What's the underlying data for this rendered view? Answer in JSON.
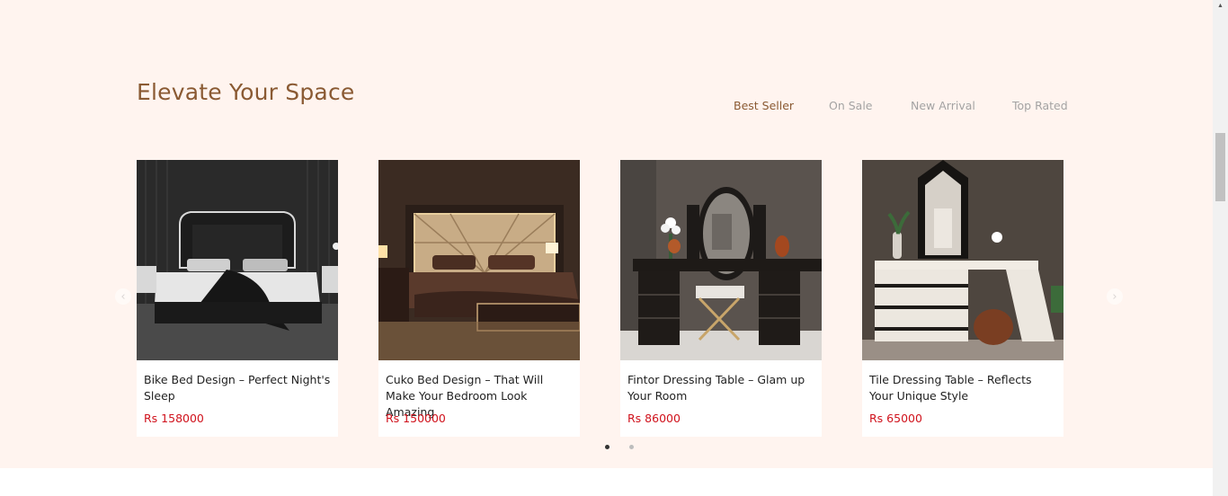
{
  "section": {
    "heading": "Elevate Your Space",
    "tabs": [
      {
        "label": "Best Seller",
        "active": true
      },
      {
        "label": "On Sale",
        "active": false
      },
      {
        "label": "New Arrival",
        "active": false
      },
      {
        "label": "Top Rated",
        "active": false
      }
    ],
    "products": [
      {
        "title": "Bike Bed Design – Perfect Night's Sleep",
        "price": "Rs 158000"
      },
      {
        "title": "Cuko Bed Design – That Will Make Your Bedroom Look Amazing",
        "price": "Rs 150000"
      },
      {
        "title": "Fintor Dressing Table – Glam up Your Room",
        "price": "Rs 86000"
      },
      {
        "title": "Tile Dressing Table – Reflects Your Unique Style",
        "price": "Rs 65000"
      }
    ],
    "carousel": {
      "prev_icon": "chevron-left-icon",
      "next_icon": "chevron-right-icon",
      "pages": 2,
      "active_page": 1
    }
  },
  "colors": {
    "section_bg": "#fff4ef",
    "heading": "#8a5a33",
    "tab_active": "#8a5a33",
    "tab_inactive": "#a3a3a3",
    "price": "#d0121c"
  }
}
